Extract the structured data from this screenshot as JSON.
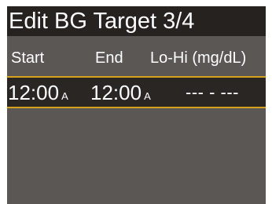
{
  "header": {
    "title": "Edit BG Target 3/4"
  },
  "columns": {
    "start": "Start",
    "end": "End",
    "range": "Lo-Hi (mg/dL)"
  },
  "segment": {
    "start_time": "12:00",
    "start_period": "A",
    "end_time": "12:00",
    "end_period": "A",
    "range_value": "--- - ---"
  },
  "colors": {
    "background": "#5b5755",
    "title_bar": "#262220",
    "selected_row": "#2a2624",
    "highlight_border": "#d6a21e",
    "text": "#ffffff"
  }
}
